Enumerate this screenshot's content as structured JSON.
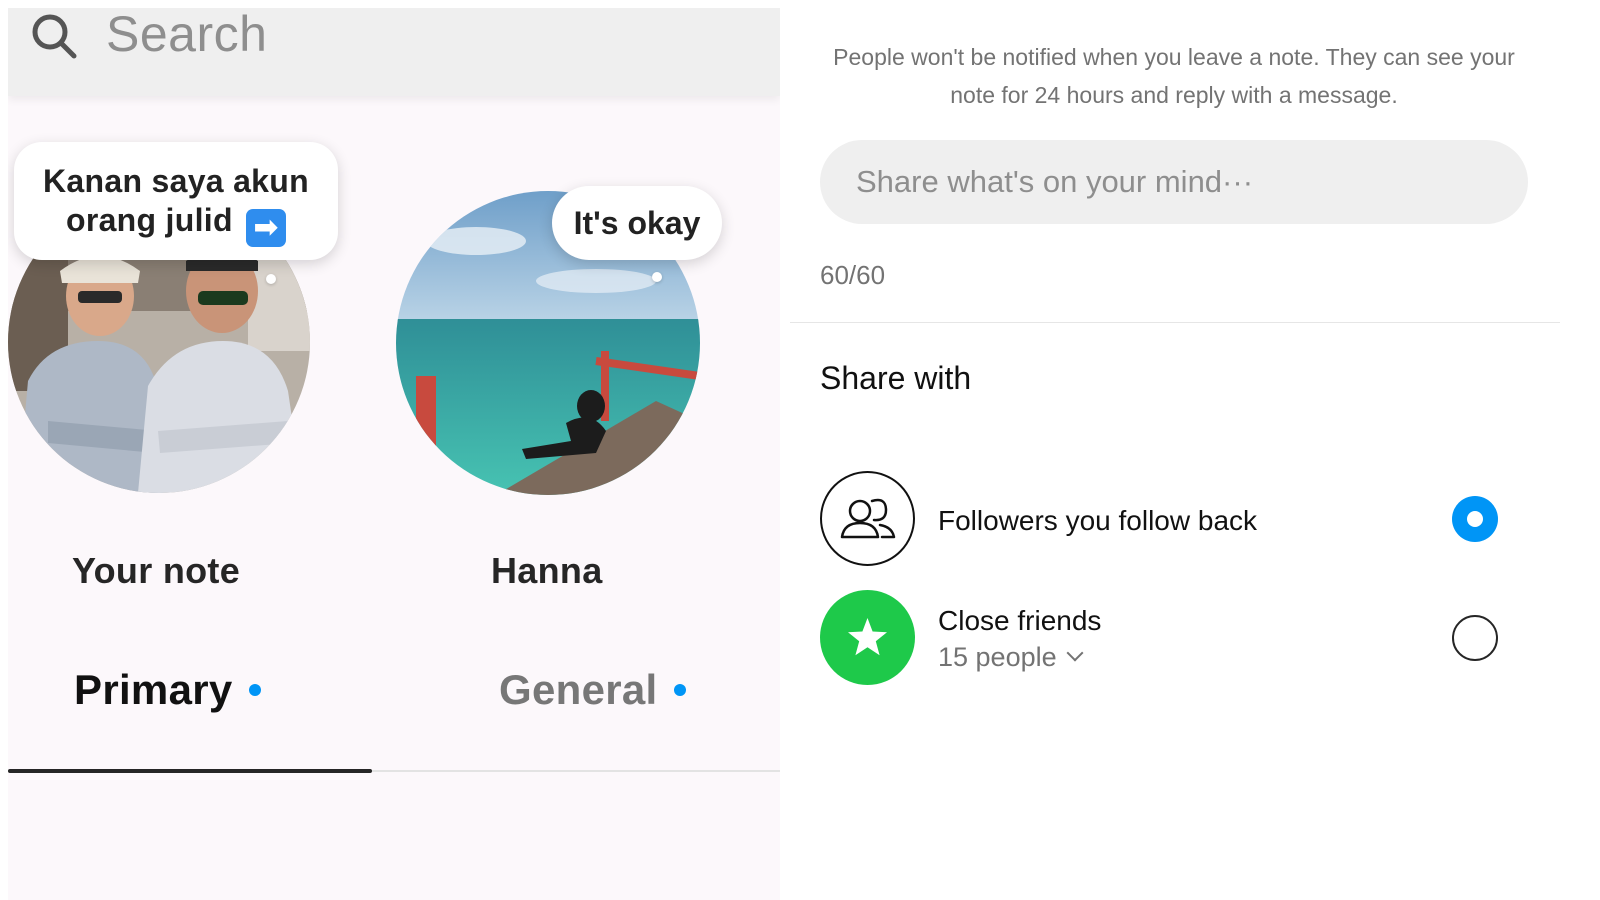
{
  "inbox": {
    "search": {
      "placeholder": "Search",
      "icon": "search-icon"
    },
    "notes": [
      {
        "bubble": "Kanan saya akun orang julid",
        "bubble_line1": "Kanan saya akun",
        "bubble_line2": "orang julid",
        "bubble_emoji": "➡",
        "label": "Your note"
      },
      {
        "bubble": "It's okay",
        "label": "Hanna"
      }
    ],
    "tabs": [
      {
        "label": "Primary",
        "active": true,
        "unread_dot": true
      },
      {
        "label": "General",
        "active": false,
        "unread_dot": true
      }
    ]
  },
  "note_sheet": {
    "notice": "People won't be notified when you leave a note. They can see your note for 24 hours and reply with a message.",
    "input_placeholder": "Share what's on your mind···",
    "counter": "60/60",
    "share_title": "Share with",
    "options": [
      {
        "title": "Followers you follow back",
        "icon": "people-icon",
        "selected": true
      },
      {
        "title": "Close friends",
        "subtitle": "15 people",
        "icon": "star-icon",
        "selected": false
      }
    ]
  },
  "colors": {
    "accent_blue": "#0095f6",
    "close_friends_green": "#1ec94a",
    "search_bg": "#efefef"
  }
}
